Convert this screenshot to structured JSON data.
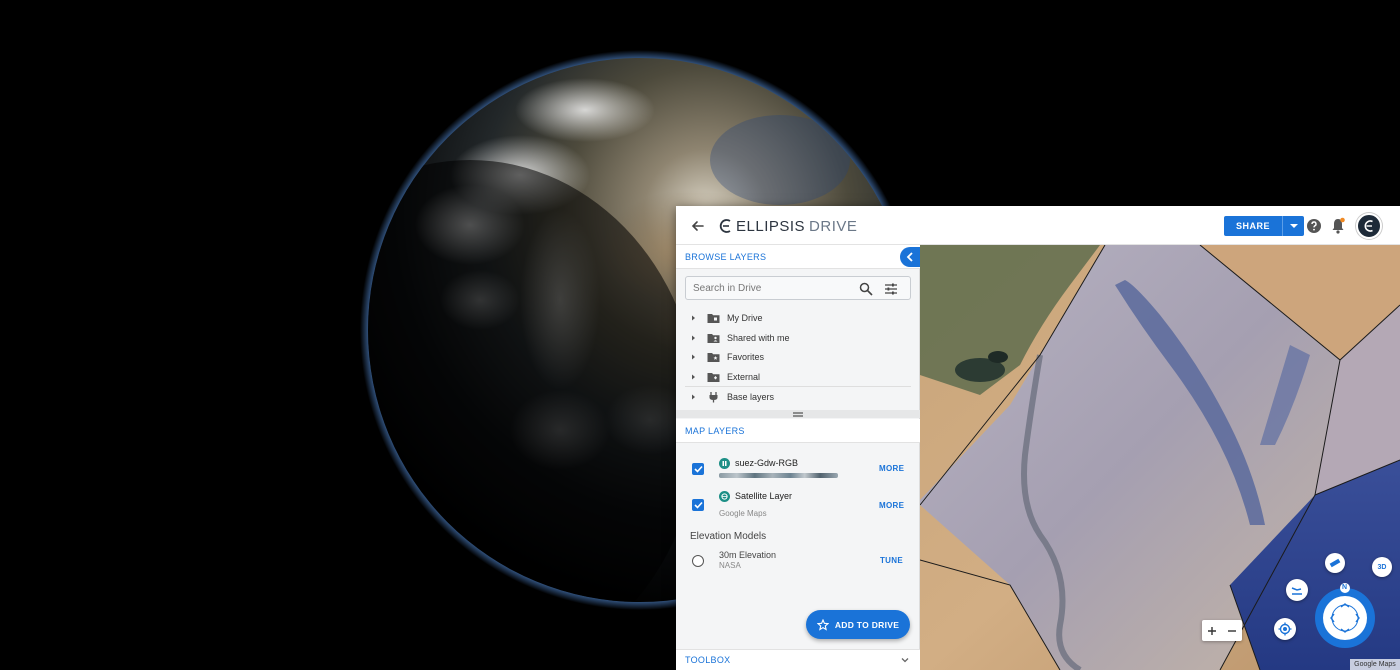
{
  "app": {
    "logo_main": "ELLIPSIS",
    "logo_sub": "DRIVE"
  },
  "header": {
    "share_label": "SHARE",
    "avatar_letter": "E"
  },
  "browse": {
    "title": "BROWSE LAYERS",
    "search_placeholder": "Search in Drive",
    "items": [
      {
        "label": "My Drive",
        "icon": "folder-icon"
      },
      {
        "label": "Shared with me",
        "icon": "shared-folder-icon"
      },
      {
        "label": "Favorites",
        "icon": "favorites-folder-icon"
      },
      {
        "label": "External",
        "icon": "external-folder-icon"
      },
      {
        "label": "Base layers",
        "icon": "plug-icon"
      }
    ]
  },
  "map_layers": {
    "title": "MAP LAYERS",
    "layers": [
      {
        "name": "suez-Gdw-RGB",
        "sub": "",
        "action": "MORE",
        "checked": true
      },
      {
        "name": "Satellite Layer",
        "sub": "Google Maps",
        "action": "MORE",
        "checked": true
      }
    ],
    "elevation_title": "Elevation Models",
    "elevation": [
      {
        "name": "30m Elevation",
        "sub": "NASA",
        "action": "TUNE",
        "checked": false
      }
    ]
  },
  "add_to_drive_label": "ADD TO DRIVE",
  "toolbox_label": "TOOLBOX",
  "map": {
    "compass_letter": "N",
    "view_3d_label": "3D",
    "attribution": "Google Maps"
  },
  "colors": {
    "accent": "#1a73d8",
    "layer_icon": "#1d8f86"
  }
}
